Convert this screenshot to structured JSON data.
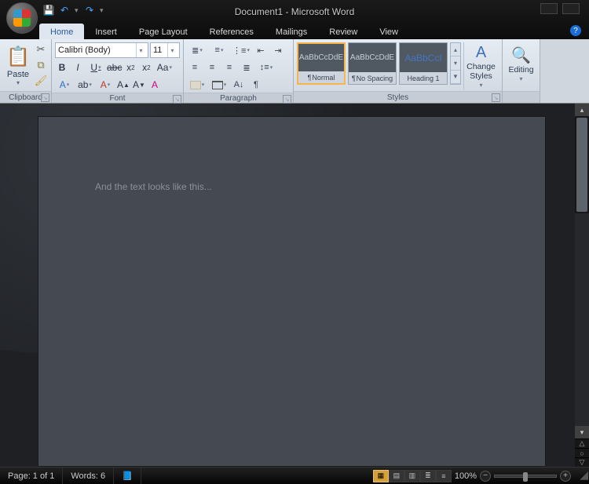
{
  "window": {
    "title": "Document1 - Microsoft Word"
  },
  "tabs": {
    "home": "Home",
    "insert": "Insert",
    "pageLayout": "Page Layout",
    "references": "References",
    "mailings": "Mailings",
    "review": "Review",
    "view": "View"
  },
  "clipboard": {
    "paste": "Paste",
    "title": "Clipboard"
  },
  "font": {
    "name": "Calibri (Body)",
    "size": "11",
    "title": "Font"
  },
  "paragraph": {
    "title": "Paragraph"
  },
  "styles": {
    "sample": "AaBbCcDdE",
    "headingSample": "AaBbCcI",
    "normal": "Normal",
    "noSpacing": "No Spacing",
    "heading1": "Heading 1",
    "changeStyles": "Change Styles",
    "title": "Styles"
  },
  "editing": {
    "label": "Editing",
    "title": "Editing"
  },
  "document": {
    "text": "And the text looks like this..."
  },
  "status": {
    "page": "Page: 1 of 1",
    "words": "Words: 6",
    "zoom": "100%"
  }
}
